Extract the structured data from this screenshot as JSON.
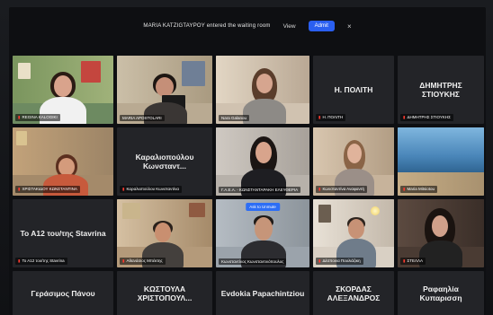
{
  "notification": {
    "message": "MARIA KATZIGTAYPOY entered the waiting room",
    "view_label": "View",
    "admit_label": "Admit",
    "close_label": "×"
  },
  "row1": [
    {
      "name": "REGINA KALOGIKI",
      "kind": "video"
    },
    {
      "name": "MARIA APOSTOLARI",
      "kind": "video"
    },
    {
      "name": "Nara Galanou",
      "kind": "video"
    },
    {
      "name": "Η. ΠΟΛΙΤΗ",
      "big": "Η. ΠΟΛΙΤΗ",
      "kind": "text"
    },
    {
      "name": "ΔΗΜΗΤΡΗΣ ΣΤΙΟΥΚΗΣ",
      "big": "ΔΗΜΗΤΡΗΣ ΣΤΙΟΥΚΗΣ",
      "kind": "text"
    }
  ],
  "row2": [
    {
      "name": "ΧΡΙΣΤΑΚΙΔΟΥ ΚΩΝΣΤΑΝΤΙΝΑ",
      "kind": "video"
    },
    {
      "name": "Καραλιοπούλου Κωνσταντίνα",
      "big": "Καραλιοπούλου Κωνσταντ...",
      "kind": "text"
    },
    {
      "name": "Γ.Α.Ε.Α. - ΚΩΝΣΤΑΝΤΑΡΑΚΗ ΕΛΕΥΘΕΡΙΑ",
      "kind": "video"
    },
    {
      "name": "Κωνσταντίνα Αναφαντή",
      "kind": "video"
    },
    {
      "name": "Maria Mitsiotou",
      "kind": "video"
    }
  ],
  "row3": [
    {
      "name": "Το Α12 του/της Stavrina",
      "big": "Το Α12 του/της Stavrina",
      "kind": "text"
    },
    {
      "name": "Αθανάσιος Μπέκτης",
      "kind": "video"
    },
    {
      "name": "Κωνσταντίνος Κωνσταντινόπουλος",
      "kind": "video",
      "badge": "Ask to Unmute"
    },
    {
      "name": "Δέσποινα Πουλιάζικη",
      "kind": "video"
    },
    {
      "name": "ΣΤΕΛΛΑ",
      "kind": "video"
    }
  ],
  "row4": [
    {
      "big": "Γεράσιμος Πάνου",
      "kind": "text"
    },
    {
      "big": "ΚΩΣΤΟΥΛΑ ΧΡΙΣΤΟΠΟΥΛ...",
      "kind": "text"
    },
    {
      "big": "Evdokia Papachintziou",
      "kind": "text"
    },
    {
      "big": "ΣΚΟΡΔΑΣ ΑΛΕΞΑΝΔΡΟΣ",
      "kind": "text"
    },
    {
      "big": "Ραφαηλία Κυπαρισση",
      "kind": "text"
    }
  ]
}
